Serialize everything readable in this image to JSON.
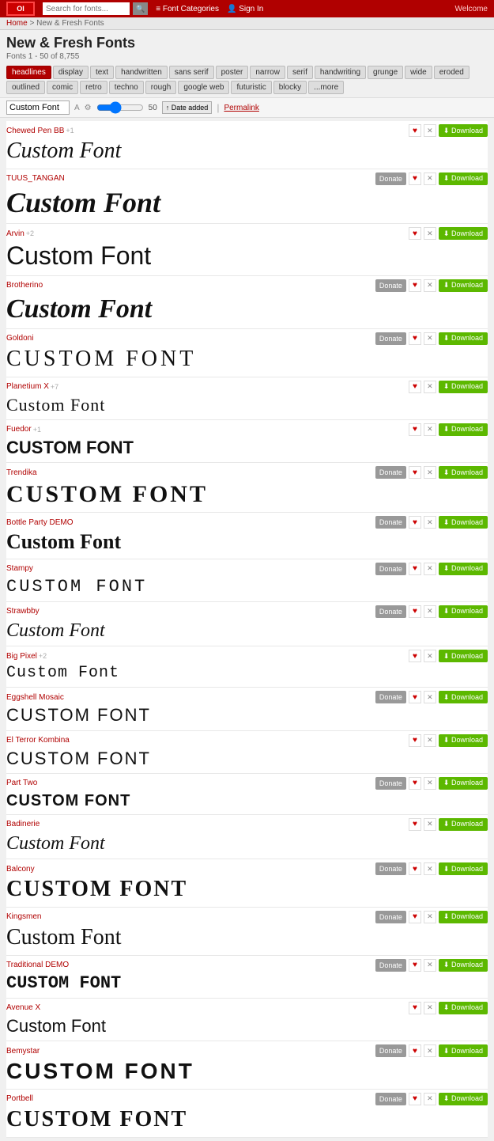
{
  "header": {
    "logo_text": "OI",
    "search_placeholder": "Search for fonts...",
    "search_btn": "🔍",
    "nav_categories": "≡ Font Categories",
    "nav_signin": "👤 Sign In",
    "welcome": "Welcome"
  },
  "breadcrumb": {
    "home": "Home",
    "separator": " > ",
    "current": "New & Fresh Fonts"
  },
  "page_title": "New & Fresh Fonts",
  "page_subtitle": "Fonts 1 - 50 of 8,755",
  "filter_tabs": [
    "headlines",
    "display",
    "text",
    "handwritten",
    "sans serif",
    "poster",
    "narrow",
    "serif",
    "handwriting",
    "grunge",
    "wide",
    "eroded",
    "outlined",
    "comic",
    "retro",
    "techno",
    "rough",
    "google web",
    "futuristic",
    "blocky",
    "...more"
  ],
  "controls": {
    "text_value": "Custom Font",
    "size_value": "50",
    "date_added": "↑ Date added",
    "permalink": "Permalink"
  },
  "fonts": [
    {
      "id": 1,
      "name": "Chewed Pen BB",
      "meta": "+1",
      "style": "chewed",
      "size_class": "fp-1",
      "preview": "Custom Font",
      "donate": false,
      "heart": true,
      "x": true
    },
    {
      "id": 2,
      "name": "TUUS_TANGAN",
      "meta": "",
      "style": "tulus",
      "size_class": "fp-2",
      "preview": "Custom Font",
      "donate": true,
      "heart": true,
      "x": true
    },
    {
      "id": 3,
      "name": "Arvin",
      "meta": "+2",
      "style": "arvin",
      "size_class": "fp-3",
      "preview": "Custom Font",
      "donate": false,
      "heart": true,
      "x": true
    },
    {
      "id": 4,
      "name": "Brotherino",
      "meta": "",
      "style": "brotherino",
      "size_class": "fp-4",
      "preview": "Custom Font",
      "donate": true,
      "heart": true,
      "x": true
    },
    {
      "id": 5,
      "name": "Goldoni",
      "meta": "",
      "style": "goldoni",
      "size_class": "fp-5",
      "preview": "CUSTOM FONT",
      "donate": true,
      "heart": true,
      "x": true
    },
    {
      "id": 6,
      "name": "Planetium X",
      "meta": "+7",
      "style": "planetium",
      "size_class": "fp-6",
      "preview": "Custom Font",
      "donate": false,
      "heart": true,
      "x": true
    },
    {
      "id": 7,
      "name": "Fuedor",
      "meta": "+1",
      "style": "fuedor",
      "size_class": "fp-7",
      "preview": "CUSTOM FONT",
      "donate": false,
      "heart": true,
      "x": true
    },
    {
      "id": 8,
      "name": "Trendika",
      "meta": "",
      "style": "trendika",
      "size_class": "fp-8",
      "preview": "CUSTOM  FONT",
      "donate": true,
      "heart": true,
      "x": true
    },
    {
      "id": 9,
      "name": "Bottle Party DEMO",
      "meta": "",
      "style": "bottle",
      "size_class": "fp-9",
      "preview": "Custom Font",
      "donate": true,
      "heart": true,
      "x": true
    },
    {
      "id": 10,
      "name": "Stampy",
      "meta": "",
      "style": "stampy",
      "size_class": "fp-10",
      "preview": "CUSTOM FONT",
      "donate": true,
      "heart": true,
      "x": true
    },
    {
      "id": 11,
      "name": "Strawbby",
      "meta": "",
      "style": "strawbby",
      "size_class": "fp-11",
      "preview": "Custom Font",
      "donate": true,
      "heart": true,
      "x": true
    },
    {
      "id": 12,
      "name": "Big Pixel",
      "meta": "+2",
      "style": "bigpixel",
      "size_class": "fp-12",
      "preview": "Custom Font",
      "donate": false,
      "heart": true,
      "x": true
    },
    {
      "id": 13,
      "name": "Eggshell Mosaic",
      "meta": "",
      "style": "eggshell",
      "size_class": "fp-13",
      "preview": "CUSTOM FONT",
      "donate": true,
      "heart": true,
      "x": true
    },
    {
      "id": 14,
      "name": "El Terror Kombina",
      "meta": "",
      "style": "elterror",
      "size_class": "fp-14",
      "preview": "CUSTOM FONT",
      "donate": false,
      "heart": true,
      "x": true
    },
    {
      "id": 15,
      "name": "Part Two",
      "meta": "",
      "style": "parttwo",
      "size_class": "fp-15",
      "preview": "CUSTOM FONT",
      "donate": true,
      "heart": true,
      "x": true
    },
    {
      "id": 16,
      "name": "Badinerie",
      "meta": "",
      "style": "badinerie",
      "size_class": "fp-18",
      "preview": "Custom Font",
      "donate": false,
      "heart": true,
      "x": true
    },
    {
      "id": 17,
      "name": "Balcony",
      "meta": "",
      "style": "balcony",
      "size_class": "fp-19",
      "preview": "CUSTOM FONT",
      "donate": true,
      "heart": true,
      "x": true
    },
    {
      "id": 18,
      "name": "Kingsmen",
      "meta": "",
      "style": "kingsmen",
      "size_class": "fp-20",
      "preview": "Custom Font",
      "donate": true,
      "heart": true,
      "x": true
    },
    {
      "id": 19,
      "name": "Traditional DEMO",
      "meta": "",
      "style": "traditional",
      "size_class": "fp-21",
      "preview": "CUSTOM FONT",
      "donate": true,
      "heart": true,
      "x": true
    },
    {
      "id": 20,
      "name": "Avenue X",
      "meta": "",
      "style": "avenue",
      "size_class": "fp-22",
      "preview": "Custom Font",
      "donate": false,
      "heart": true,
      "x": true
    },
    {
      "id": 21,
      "name": "Bemystar",
      "meta": "",
      "style": "bemystar",
      "size_class": "fp-24",
      "preview": "CUSTOM FONT",
      "donate": true,
      "heart": true,
      "x": true
    },
    {
      "id": 22,
      "name": "Portbell",
      "meta": "",
      "style": "portbell",
      "size_class": "fp-25",
      "preview": "CUSTOM FONT",
      "donate": true,
      "heart": true,
      "x": true
    }
  ]
}
